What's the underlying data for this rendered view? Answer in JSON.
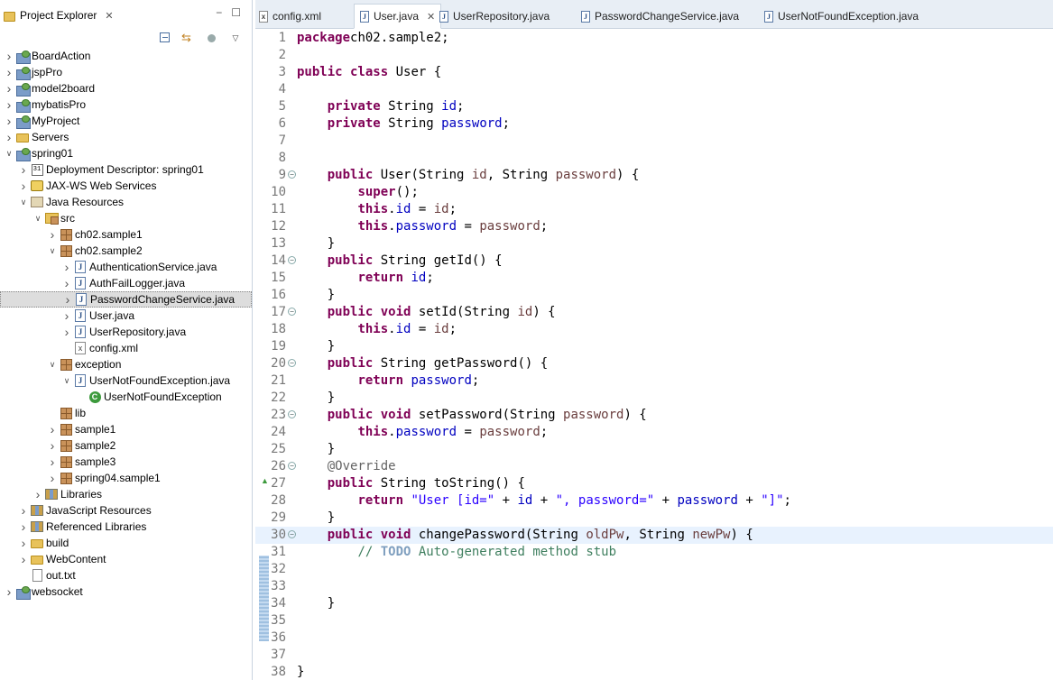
{
  "explorer": {
    "title": "Project Explorer",
    "tree": [
      {
        "label": "BoardAction",
        "level": 0,
        "expanded": false,
        "icon": "project-icon"
      },
      {
        "label": "jspPro",
        "level": 0,
        "expanded": false,
        "icon": "project-icon"
      },
      {
        "label": "model2board",
        "level": 0,
        "expanded": false,
        "icon": "project-icon"
      },
      {
        "label": "mybatisPro",
        "level": 0,
        "expanded": false,
        "icon": "project-icon"
      },
      {
        "label": "MyProject",
        "level": 0,
        "expanded": false,
        "icon": "project-icon"
      },
      {
        "label": "Servers",
        "level": 0,
        "expanded": false,
        "icon": "folder-icon"
      },
      {
        "label": "spring01",
        "level": 0,
        "expanded": true,
        "icon": "project-icon"
      },
      {
        "label": "Deployment Descriptor: spring01",
        "level": 1,
        "expanded": false,
        "icon": "deployment-descriptor-icon"
      },
      {
        "label": "JAX-WS Web Services",
        "level": 1,
        "expanded": false,
        "icon": "web-services-icon"
      },
      {
        "label": "Java Resources",
        "level": 1,
        "expanded": true,
        "icon": "java-resources-icon"
      },
      {
        "label": "src",
        "level": 2,
        "expanded": true,
        "icon": "source-folder-icon"
      },
      {
        "label": "ch02.sample1",
        "level": 3,
        "expanded": false,
        "icon": "package-icon"
      },
      {
        "label": "ch02.sample2",
        "level": 3,
        "expanded": true,
        "icon": "package-icon"
      },
      {
        "label": "AuthenticationService.java",
        "level": 4,
        "expanded": false,
        "icon": "java-file-icon"
      },
      {
        "label": "AuthFailLogger.java",
        "level": 4,
        "expanded": false,
        "icon": "java-file-icon"
      },
      {
        "label": "PasswordChangeService.java",
        "level": 4,
        "expanded": false,
        "icon": "java-file-icon",
        "selected": true
      },
      {
        "label": "User.java",
        "level": 4,
        "expanded": false,
        "icon": "java-file-icon"
      },
      {
        "label": "UserRepository.java",
        "level": 4,
        "expanded": false,
        "icon": "java-file-icon"
      },
      {
        "label": "config.xml",
        "level": 4,
        "expanded": null,
        "icon": "xml-file-icon"
      },
      {
        "label": "exception",
        "level": 3,
        "expanded": true,
        "icon": "package-icon"
      },
      {
        "label": "UserNotFoundException.java",
        "level": 4,
        "expanded": true,
        "icon": "java-file-icon"
      },
      {
        "label": "UserNotFoundException",
        "level": 5,
        "expanded": null,
        "icon": "class-icon"
      },
      {
        "label": "lib",
        "level": 3,
        "expanded": null,
        "icon": "package-icon"
      },
      {
        "label": "sample1",
        "level": 3,
        "expanded": false,
        "icon": "package-icon"
      },
      {
        "label": "sample2",
        "level": 3,
        "expanded": false,
        "icon": "package-icon"
      },
      {
        "label": "sample3",
        "level": 3,
        "expanded": false,
        "icon": "package-icon"
      },
      {
        "label": "spring04.sample1",
        "level": 3,
        "expanded": false,
        "icon": "package-icon"
      },
      {
        "label": "Libraries",
        "level": 2,
        "expanded": false,
        "icon": "libraries-icon"
      },
      {
        "label": "JavaScript Resources",
        "level": 1,
        "expanded": false,
        "icon": "javascript-resources-icon"
      },
      {
        "label": "Referenced Libraries",
        "level": 1,
        "expanded": false,
        "icon": "libraries-icon"
      },
      {
        "label": "build",
        "level": 1,
        "expanded": false,
        "icon": "folder-icon"
      },
      {
        "label": "WebContent",
        "level": 1,
        "expanded": false,
        "icon": "folder-icon"
      },
      {
        "label": "out.txt",
        "level": 1,
        "expanded": null,
        "icon": "text-file-icon"
      },
      {
        "label": "websocket",
        "level": 0,
        "expanded": false,
        "icon": "project-icon"
      }
    ]
  },
  "editor": {
    "tabs": [
      {
        "label": "config.xml",
        "active": false,
        "icon": "xml-file-icon"
      },
      {
        "label": "User.java",
        "active": true,
        "icon": "java-file-icon"
      },
      {
        "label": "UserRepository.java",
        "active": false,
        "icon": "java-file-icon"
      },
      {
        "label": "PasswordChangeService.java",
        "active": false,
        "icon": "java-file-icon"
      },
      {
        "label": "UserNotFoundException.java",
        "active": false,
        "icon": "java-file-icon"
      }
    ],
    "current_line": 30,
    "lines": [
      {
        "n": "1",
        "tokens": [
          [
            "kw",
            "package"
          ],
          [
            "",
            "ch02.sample2;"
          ]
        ]
      },
      {
        "n": "2",
        "tokens": []
      },
      {
        "n": "3",
        "tokens": [
          [
            "kw",
            "public class"
          ],
          [
            "",
            " User {"
          ]
        ]
      },
      {
        "n": "4",
        "tokens": []
      },
      {
        "n": "5",
        "tokens": [
          [
            "",
            "    "
          ],
          [
            "kw",
            "private"
          ],
          [
            "",
            " String "
          ],
          [
            "fld",
            "id"
          ],
          [
            "",
            ";"
          ]
        ]
      },
      {
        "n": "6",
        "tokens": [
          [
            "",
            "    "
          ],
          [
            "kw",
            "private"
          ],
          [
            "",
            " String "
          ],
          [
            "fld",
            "password"
          ],
          [
            "",
            ";"
          ]
        ]
      },
      {
        "n": "7",
        "tokens": []
      },
      {
        "n": "8",
        "tokens": []
      },
      {
        "n": "9",
        "fold": true,
        "tokens": [
          [
            "",
            "    "
          ],
          [
            "kw",
            "public"
          ],
          [
            "",
            " User(String "
          ],
          [
            "param",
            "id"
          ],
          [
            "",
            ", String "
          ],
          [
            "param",
            "password"
          ],
          [
            "",
            ") {"
          ]
        ]
      },
      {
        "n": "10",
        "tokens": [
          [
            "",
            "        "
          ],
          [
            "kw",
            "super"
          ],
          [
            "",
            "();"
          ]
        ]
      },
      {
        "n": "11",
        "tokens": [
          [
            "",
            "        "
          ],
          [
            "kw",
            "this"
          ],
          [
            "",
            "."
          ],
          [
            "fld",
            "id"
          ],
          [
            "",
            " = "
          ],
          [
            "param",
            "id"
          ],
          [
            "",
            ";"
          ]
        ]
      },
      {
        "n": "12",
        "tokens": [
          [
            "",
            "        "
          ],
          [
            "kw",
            "this"
          ],
          [
            "",
            "."
          ],
          [
            "fld",
            "password"
          ],
          [
            "",
            " = "
          ],
          [
            "param",
            "password"
          ],
          [
            "",
            ";"
          ]
        ]
      },
      {
        "n": "13",
        "tokens": [
          [
            "",
            "    }"
          ]
        ]
      },
      {
        "n": "14",
        "fold": true,
        "tokens": [
          [
            "",
            "    "
          ],
          [
            "kw",
            "public"
          ],
          [
            "",
            " String getId() {"
          ]
        ]
      },
      {
        "n": "15",
        "tokens": [
          [
            "",
            "        "
          ],
          [
            "kw",
            "return"
          ],
          [
            "",
            " "
          ],
          [
            "fld",
            "id"
          ],
          [
            "",
            ";"
          ]
        ]
      },
      {
        "n": "16",
        "tokens": [
          [
            "",
            "    }"
          ]
        ]
      },
      {
        "n": "17",
        "fold": true,
        "tokens": [
          [
            "",
            "    "
          ],
          [
            "kw",
            "public void"
          ],
          [
            "",
            " setId(String "
          ],
          [
            "param",
            "id"
          ],
          [
            "",
            ") {"
          ]
        ]
      },
      {
        "n": "18",
        "tokens": [
          [
            "",
            "        "
          ],
          [
            "kw",
            "this"
          ],
          [
            "",
            "."
          ],
          [
            "fld",
            "id"
          ],
          [
            "",
            " = "
          ],
          [
            "param",
            "id"
          ],
          [
            "",
            ";"
          ]
        ]
      },
      {
        "n": "19",
        "tokens": [
          [
            "",
            "    }"
          ]
        ]
      },
      {
        "n": "20",
        "fold": true,
        "tokens": [
          [
            "",
            "    "
          ],
          [
            "kw",
            "public"
          ],
          [
            "",
            " String getPassword() {"
          ]
        ]
      },
      {
        "n": "21",
        "tokens": [
          [
            "",
            "        "
          ],
          [
            "kw",
            "return"
          ],
          [
            "",
            " "
          ],
          [
            "fld",
            "password"
          ],
          [
            "",
            ";"
          ]
        ]
      },
      {
        "n": "22",
        "tokens": [
          [
            "",
            "    }"
          ]
        ]
      },
      {
        "n": "23",
        "fold": true,
        "tokens": [
          [
            "",
            "    "
          ],
          [
            "kw",
            "public void"
          ],
          [
            "",
            " setPassword(String "
          ],
          [
            "param",
            "password"
          ],
          [
            "",
            ") {"
          ]
        ]
      },
      {
        "n": "24",
        "tokens": [
          [
            "",
            "        "
          ],
          [
            "kw",
            "this"
          ],
          [
            "",
            "."
          ],
          [
            "fld",
            "password"
          ],
          [
            "",
            " = "
          ],
          [
            "param",
            "password"
          ],
          [
            "",
            ";"
          ]
        ]
      },
      {
        "n": "25",
        "tokens": [
          [
            "",
            "    }"
          ]
        ]
      },
      {
        "n": "26",
        "fold": true,
        "tokens": [
          [
            "",
            "    "
          ],
          [
            "ann",
            "@Override"
          ]
        ]
      },
      {
        "n": "27",
        "override": true,
        "tokens": [
          [
            "",
            "    "
          ],
          [
            "kw",
            "public"
          ],
          [
            "",
            " String toString() {"
          ]
        ]
      },
      {
        "n": "28",
        "tokens": [
          [
            "",
            "        "
          ],
          [
            "kw",
            "return"
          ],
          [
            "",
            " "
          ],
          [
            "str",
            "\"User [id=\""
          ],
          [
            "",
            " + "
          ],
          [
            "fld",
            "id"
          ],
          [
            "",
            " + "
          ],
          [
            "str",
            "\", password=\""
          ],
          [
            "",
            " + "
          ],
          [
            "fld",
            "password"
          ],
          [
            "",
            " + "
          ],
          [
            "str",
            "\"]\""
          ],
          [
            "",
            ";"
          ]
        ]
      },
      {
        "n": "29",
        "tokens": [
          [
            "",
            "    }"
          ]
        ]
      },
      {
        "n": "30",
        "fold": true,
        "tokens": [
          [
            "",
            "    "
          ],
          [
            "kw",
            "public void"
          ],
          [
            "",
            " changePassword(String "
          ],
          [
            "param",
            "oldPw"
          ],
          [
            "",
            ", String "
          ],
          [
            "param",
            "newPw"
          ],
          [
            "",
            ") {"
          ]
        ]
      },
      {
        "n": "31",
        "tokens": [
          [
            "",
            "        "
          ],
          [
            "cmt",
            "// "
          ],
          [
            "todo",
            "TODO"
          ],
          [
            "cmt",
            " Auto-generated method stub"
          ]
        ]
      },
      {
        "n": "32",
        "tokens": []
      },
      {
        "n": "33",
        "tokens": []
      },
      {
        "n": "34",
        "tokens": [
          [
            "",
            "    }"
          ]
        ]
      },
      {
        "n": "35",
        "tokens": []
      },
      {
        "n": "36",
        "tokens": []
      },
      {
        "n": "37",
        "tokens": []
      },
      {
        "n": "38",
        "tokens": [
          [
            "",
            "}"
          ]
        ]
      }
    ]
  }
}
